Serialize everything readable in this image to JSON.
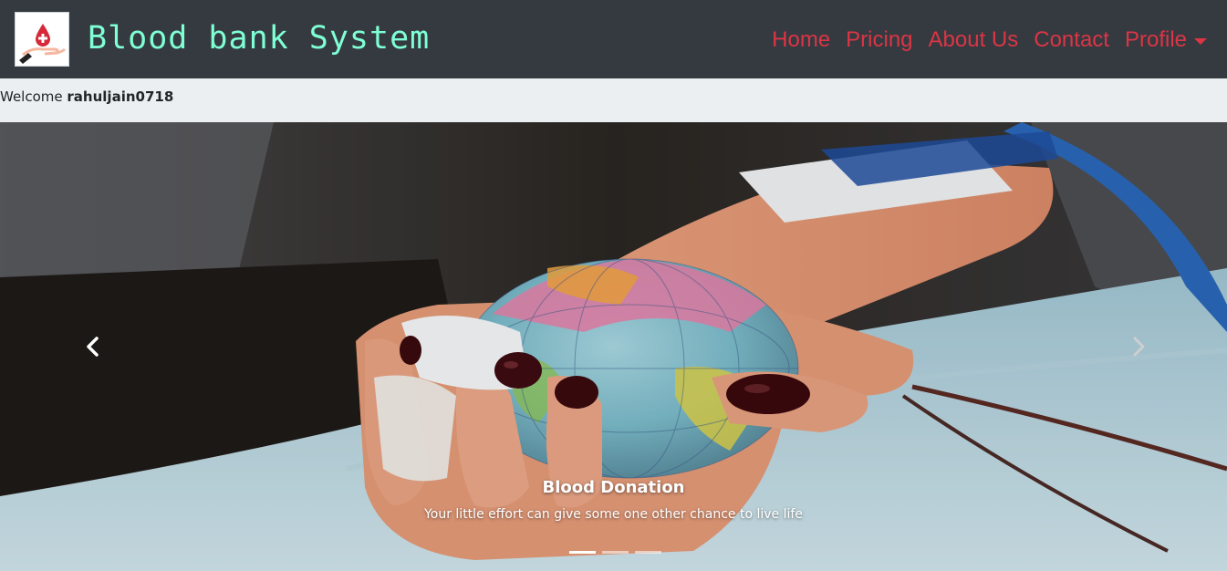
{
  "header": {
    "brand_title": "Blood bank System",
    "logo_icon": "blood-drop-hand-logo",
    "nav": [
      {
        "label": "Home"
      },
      {
        "label": "Pricing"
      },
      {
        "label": "About Us"
      },
      {
        "label": "Contact"
      }
    ],
    "profile_label": "Profile",
    "accent_color": "#dc3545",
    "brand_color": "#7fffd4",
    "navbar_bg": "#343a40"
  },
  "welcome": {
    "prefix": "Welcome",
    "username": "rahuljain0718"
  },
  "carousel": {
    "caption_title": "Blood Donation",
    "caption_text": "Your little effort can give some one other chance to live life",
    "slide_count": 3,
    "active_slide": 1,
    "prev_icon": "chevron-left-icon",
    "next_icon": "chevron-right-icon"
  }
}
